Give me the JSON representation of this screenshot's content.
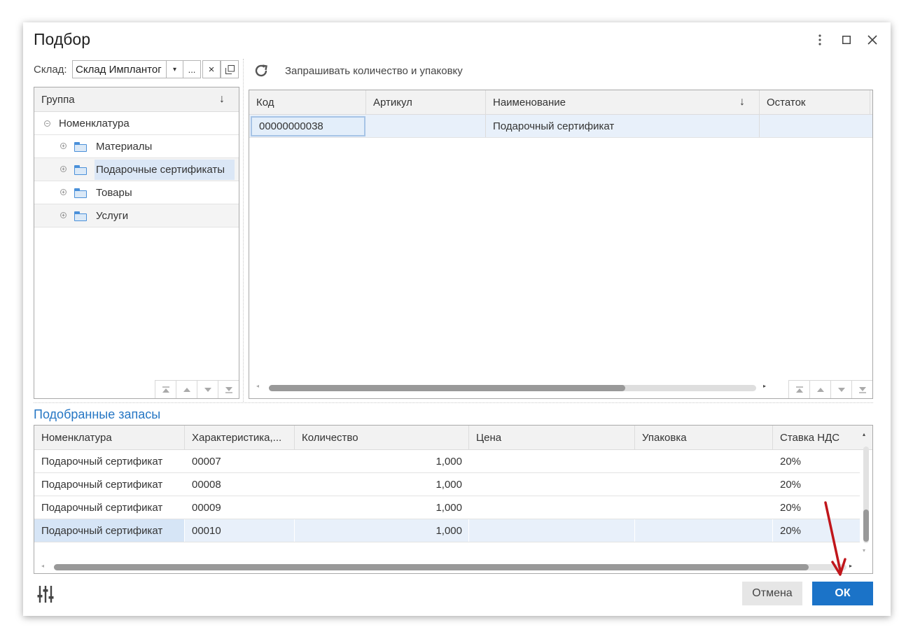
{
  "window": {
    "title": "Подбор"
  },
  "warehouse": {
    "label": "Склад:",
    "value": "Склад Имплантог",
    "dropdown_glyph": "▾",
    "select_glyph": "...",
    "clear_glyph": "×",
    "open_glyph": "⧉"
  },
  "toolbar": {
    "refresh_icon": "refresh-icon",
    "ask_quantity_label": "Запрашивать количество и упаковку"
  },
  "groups": {
    "header": "Группа",
    "sort_glyph": "↓",
    "root": "Номенклатура",
    "items": [
      "Материалы",
      "Подарочные сертификаты",
      "Товары",
      "Услуги"
    ],
    "selected_index": 1
  },
  "items_table": {
    "columns": [
      "Код",
      "Артикул",
      "Наименование",
      "Остаток"
    ],
    "sort_glyph": "↓",
    "rows": [
      {
        "code": "00000000038",
        "article": "",
        "name": "Подарочный сертификат",
        "stock": ""
      }
    ]
  },
  "picked": {
    "title": "Подобранные запасы",
    "columns": [
      "Номенклатура",
      "Характеристика,...",
      "Количество",
      "Цена",
      "Упаковка",
      "Ставка НДС"
    ],
    "rows": [
      {
        "item": "Подарочный сертификат",
        "characteristic": "00007",
        "quantity": "1,000",
        "price": "",
        "package": "",
        "vat": "20%"
      },
      {
        "item": "Подарочный сертификат",
        "characteristic": "00008",
        "quantity": "1,000",
        "price": "",
        "package": "",
        "vat": "20%"
      },
      {
        "item": "Подарочный сертификат",
        "characteristic": "00009",
        "quantity": "1,000",
        "price": "",
        "package": "",
        "vat": "20%"
      },
      {
        "item": "Подарочный сертификат",
        "characteristic": "00010",
        "quantity": "1,000",
        "price": "",
        "package": "",
        "vat": "20%"
      }
    ],
    "selected_index": 3
  },
  "footer": {
    "settings_icon": "sliders-icon",
    "cancel_label": "Отмена",
    "ok_label": "ОК"
  },
  "colors": {
    "accent": "#1b73c8",
    "title_blue": "#2576c4",
    "selection": "#e3eefa",
    "annotation_arrow": "#c0161b"
  }
}
